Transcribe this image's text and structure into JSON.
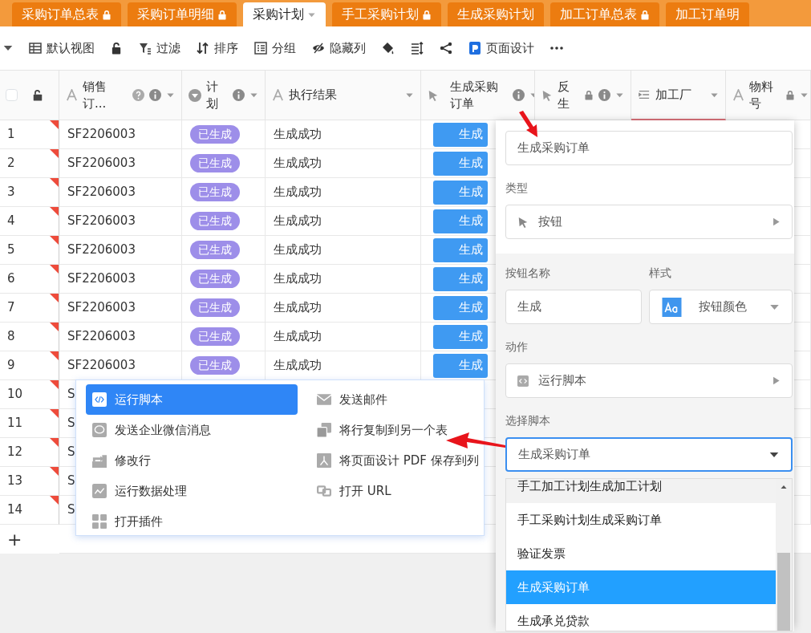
{
  "tabs": [
    {
      "label": "采购订单总表",
      "locked": true,
      "selected": false
    },
    {
      "label": "采购订单明细",
      "locked": true,
      "selected": false
    },
    {
      "label": "采购计划",
      "locked": false,
      "selected": true
    },
    {
      "label": "手工采购计划",
      "locked": true,
      "selected": false
    },
    {
      "label": "生成采购计划",
      "locked": false,
      "selected": false
    },
    {
      "label": "加工订单总表",
      "locked": true,
      "selected": false
    },
    {
      "label": "加工订单明",
      "locked": false,
      "selected": false
    }
  ],
  "toolbar": [
    {
      "kind": "view",
      "label": "默认视图"
    },
    {
      "kind": "lock"
    },
    {
      "kind": "filter",
      "label": "过滤"
    },
    {
      "kind": "sort",
      "label": "排序"
    },
    {
      "kind": "group",
      "label": "分组"
    },
    {
      "kind": "hide",
      "label": "隐藏列"
    },
    {
      "kind": "paint"
    },
    {
      "kind": "rowheight"
    },
    {
      "kind": "share"
    },
    {
      "kind": "design",
      "label": "页面设计"
    },
    {
      "kind": "more"
    }
  ],
  "select_all": {
    "checked": false
  },
  "columns": [
    {
      "label": "销售订...",
      "kind": "text",
      "help": true,
      "info": true,
      "locked": false,
      "highlighted": false
    },
    {
      "label": "计划",
      "kind": "select",
      "help": false,
      "info": true,
      "locked": false,
      "highlighted": false
    },
    {
      "label": "执行结果",
      "kind": "text",
      "help": false,
      "info": false,
      "locked": false,
      "highlighted": false
    },
    {
      "label": "生成采购订单",
      "kind": "button",
      "help": false,
      "info": true,
      "locked": false,
      "highlighted": false
    },
    {
      "label": "反生",
      "kind": "button",
      "help": false,
      "info": true,
      "locked": true,
      "highlighted": false
    },
    {
      "label": "加工厂",
      "kind": "list",
      "help": false,
      "info": false,
      "locked": false,
      "highlighted": true
    },
    {
      "label": "物料号",
      "kind": "text",
      "help": false,
      "info": false,
      "locked": true,
      "highlighted": false
    }
  ],
  "rows": [
    {
      "number": "1",
      "sales_order": "SF2206003",
      "plan": "已生成",
      "result": "生成成功",
      "button": "生成"
    },
    {
      "number": "2",
      "sales_order": "SF2206003",
      "plan": "已生成",
      "result": "生成成功",
      "button": "生成"
    },
    {
      "number": "3",
      "sales_order": "SF2206003",
      "plan": "已生成",
      "result": "生成成功",
      "button": "生成"
    },
    {
      "number": "4",
      "sales_order": "SF2206003",
      "plan": "已生成",
      "result": "生成成功",
      "button": "生成"
    },
    {
      "number": "5",
      "sales_order": "SF2206003",
      "plan": "已生成",
      "result": "生成成功",
      "button": "生成"
    },
    {
      "number": "6",
      "sales_order": "SF2206003",
      "plan": "已生成",
      "result": "生成成功",
      "button": "生成"
    },
    {
      "number": "7",
      "sales_order": "SF2206003",
      "plan": "已生成",
      "result": "生成成功",
      "button": "生成"
    },
    {
      "number": "8",
      "sales_order": "SF2206003",
      "plan": "已生成",
      "result": "生成成功",
      "button": "生成"
    },
    {
      "number": "9",
      "sales_order": "SF2206003",
      "plan": "已生成",
      "result": "生成成功",
      "button": "生成"
    },
    {
      "number": "10",
      "sales_order": "S"
    },
    {
      "number": "11",
      "sales_order": "S"
    },
    {
      "number": "12",
      "sales_order": "S"
    },
    {
      "number": "13",
      "sales_order": "S"
    },
    {
      "number": "14",
      "sales_order": "S"
    }
  ],
  "add_row": "+",
  "action_menu": [
    {
      "label": "运行脚本",
      "kind": "script",
      "selected": true
    },
    {
      "label": "发送邮件",
      "kind": "mail",
      "selected": false
    },
    {
      "label": "发送企业微信消息",
      "kind": "chat",
      "selected": false
    },
    {
      "label": "将行复制到另一个表",
      "kind": "copy",
      "selected": false
    },
    {
      "label": "修改行",
      "kind": "edit",
      "selected": false
    },
    {
      "label": "将页面设计 PDF 保存到列",
      "kind": "pdf",
      "selected": false
    },
    {
      "label": "运行数据处理",
      "kind": "chart",
      "selected": false
    },
    {
      "label": "打开 URL",
      "kind": "link",
      "selected": false
    },
    {
      "label": "打开插件",
      "kind": "plugin",
      "selected": false
    }
  ],
  "field_panel": {
    "name_value": "生成采购订单",
    "type_label": "类型",
    "type_value": "按钮",
    "button_name_label": "按钮名称",
    "button_name_value": "生成",
    "style_label": "样式",
    "style_value": "按钮颜色",
    "action_label": "动作",
    "action_value": "运行脚本",
    "script_label": "选择脚本",
    "script_value": "生成采购订单",
    "script_options": [
      {
        "label": "手工加工计划生成加工计划",
        "selected": false,
        "hovered": true
      },
      {
        "label": "手工采购计划生成采购订单",
        "selected": false,
        "hovered": false
      },
      {
        "label": "验证发票",
        "selected": false,
        "hovered": false
      },
      {
        "label": "生成采购订单",
        "selected": true,
        "hovered": false
      },
      {
        "label": "生成承兑贷款",
        "selected": false,
        "hovered": false
      }
    ]
  }
}
